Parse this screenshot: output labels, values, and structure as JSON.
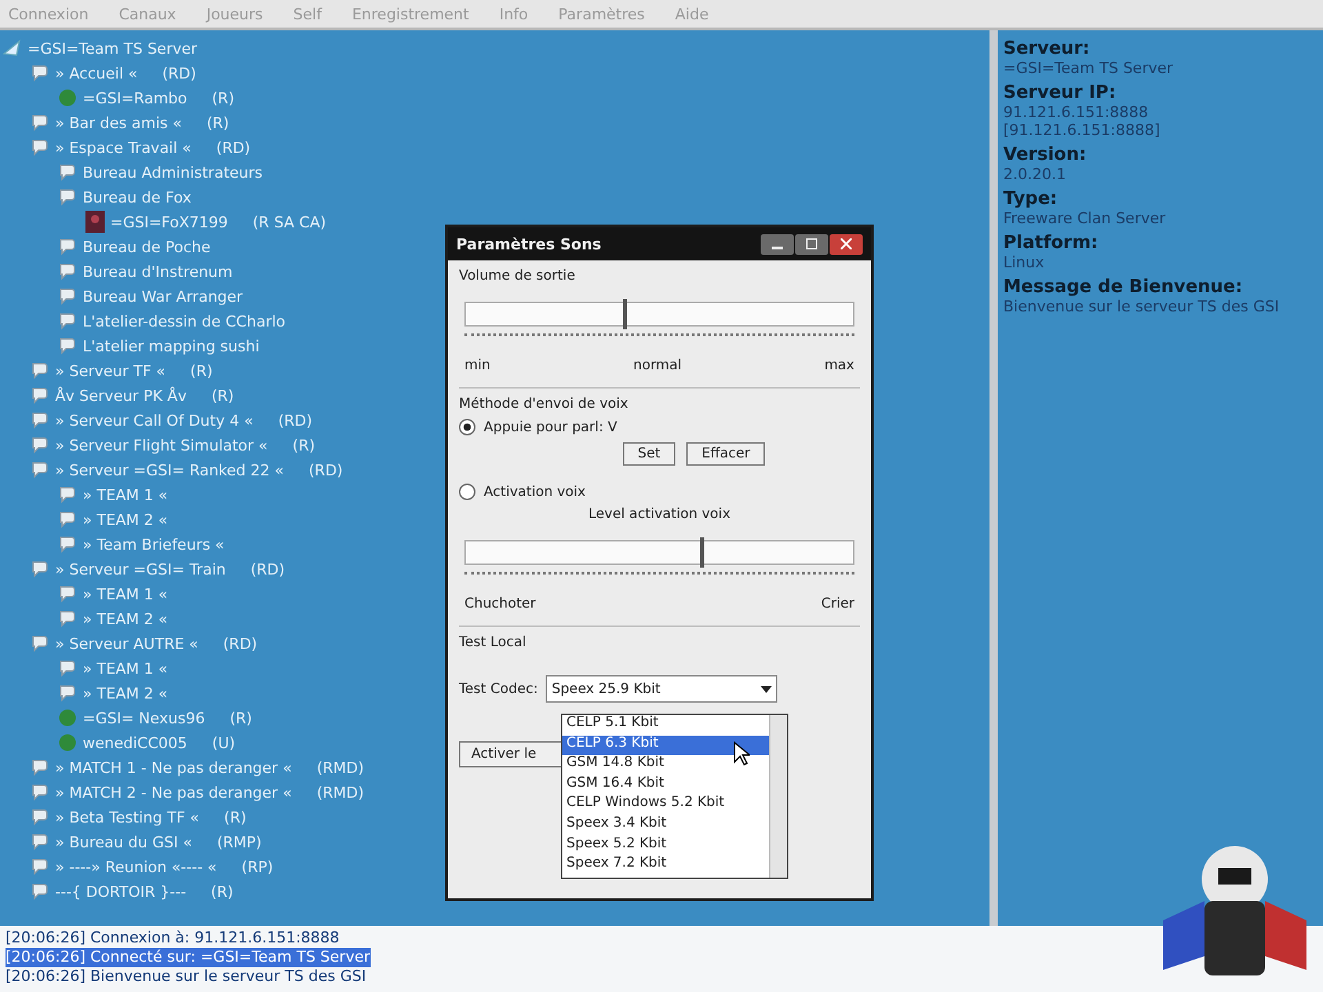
{
  "menu": [
    {
      "label": "Connexion"
    },
    {
      "label": "Canaux"
    },
    {
      "label": "Joueurs"
    },
    {
      "label": "Self"
    },
    {
      "label": "Enregistrement"
    },
    {
      "label": "Info"
    },
    {
      "label": "Paramètres"
    },
    {
      "label": "Aide"
    }
  ],
  "tree": [
    {
      "kind": "server",
      "name": "=GSI=Team TS Server",
      "children": [
        {
          "kind": "channel",
          "name": "» Accueil «",
          "flags": "(RD)",
          "children": [
            {
              "kind": "player",
              "name": "=GSI=Rambo",
              "flags": "(R)"
            }
          ]
        },
        {
          "kind": "channel",
          "name": "» Bar des amis «",
          "flags": "(R)"
        },
        {
          "kind": "channel",
          "name": "» Espace Travail «",
          "flags": "(RD)",
          "children": [
            {
              "kind": "channel",
              "name": "Bureau Administrateurs"
            },
            {
              "kind": "channel",
              "name": "Bureau de Fox",
              "children": [
                {
                  "kind": "admin",
                  "name": "=GSI=FoX7199",
                  "flags": "(R SA CA)"
                }
              ]
            },
            {
              "kind": "channel",
              "name": "Bureau de Poche"
            },
            {
              "kind": "channel",
              "name": "Bureau d'Instrenum"
            },
            {
              "kind": "channel",
              "name": "Bureau War Arranger"
            },
            {
              "kind": "channel",
              "name": "L'atelier-dessin de CCharlo"
            },
            {
              "kind": "channel",
              "name": "L'atelier mapping sushi"
            }
          ]
        },
        {
          "kind": "channel",
          "name": "» Serveur TF «",
          "flags": "(R)"
        },
        {
          "kind": "channel",
          "name": "Åv Serveur PK Åv",
          "flags": "(R)"
        },
        {
          "kind": "channel",
          "name": "» Serveur Call Of Duty 4 «",
          "flags": "(RD)"
        },
        {
          "kind": "channel",
          "name": "» Serveur Flight Simulator «",
          "flags": "(R)"
        },
        {
          "kind": "channel",
          "name": "» Serveur =GSI= Ranked 22 «",
          "flags": "(RD)",
          "children": [
            {
              "kind": "channel",
              "name": "» TEAM 1 «"
            },
            {
              "kind": "channel",
              "name": "» TEAM 2 «"
            },
            {
              "kind": "channel",
              "name": "» Team Briefeurs «"
            }
          ]
        },
        {
          "kind": "channel",
          "name": "» Serveur =GSI= Train",
          "flags": "(RD)",
          "children": [
            {
              "kind": "channel",
              "name": "» TEAM 1 «"
            },
            {
              "kind": "channel",
              "name": "» TEAM 2 «"
            }
          ]
        },
        {
          "kind": "channel",
          "name": "» Serveur AUTRE «",
          "flags": "(RD)",
          "children": [
            {
              "kind": "channel",
              "name": "» TEAM 1 «"
            },
            {
              "kind": "channel",
              "name": "» TEAM 2 «"
            },
            {
              "kind": "player",
              "name": "=GSI= Nexus96",
              "flags": "(R)"
            },
            {
              "kind": "player",
              "name": "wenediCC005",
              "flags": "(U)"
            }
          ]
        },
        {
          "kind": "channel",
          "name": "» MATCH 1 - Ne pas deranger «",
          "flags": "(RMD)"
        },
        {
          "kind": "channel",
          "name": "» MATCH 2 - Ne pas deranger «",
          "flags": "(RMD)"
        },
        {
          "kind": "channel",
          "name": "» Beta Testing TF «",
          "flags": "(R)"
        },
        {
          "kind": "channel",
          "name": "» Bureau du GSI «",
          "flags": "(RMP)"
        },
        {
          "kind": "channel",
          "name": "» ----» Reunion «---- «",
          "flags": "(RP)"
        },
        {
          "kind": "channel",
          "name": "---{ DORTOIR }---",
          "flags": "(R)"
        }
      ]
    }
  ],
  "info": [
    {
      "label": "Serveur:",
      "lines": [
        "=GSI=Team TS Server"
      ]
    },
    {
      "label": "Serveur IP:",
      "lines": [
        "91.121.6.151:8888",
        "[91.121.6.151:8888]"
      ]
    },
    {
      "label": "Version:",
      "lines": [
        "2.0.20.1"
      ]
    },
    {
      "label": "Type:",
      "lines": [
        "Freeware Clan Server"
      ]
    },
    {
      "label": "Platform:",
      "lines": [
        "Linux"
      ]
    },
    {
      "label": "Message de Bienvenue:",
      "lines": [
        "Bienvenue sur le serveur TS des GSI"
      ]
    }
  ],
  "log": [
    {
      "text": "[20:06:26] Connexion à: 91.121.6.151:8888",
      "selected": false
    },
    {
      "text": "[20:06:26] Connecté sur: =GSI=Team TS Server",
      "selected": true
    },
    {
      "text": "[20:06:26] Bienvenue sur le serveur TS des GSI",
      "selected": false
    }
  ],
  "dialog": {
    "title": "Paramètres Sons",
    "output_volume": {
      "label": "Volume de sortie",
      "level": 0.41,
      "ticks": [
        "min",
        "normal",
        "max"
      ]
    },
    "voice_method": {
      "label": "Méthode d'envoi de voix",
      "push_to_talk": {
        "label": "Appuie pour parl: V",
        "selected": true
      },
      "buttons": [
        "Set",
        "Effacer"
      ],
      "voice_activation": {
        "label": "Activation voix",
        "selected": false
      },
      "activation_level": {
        "label": "Level activation voix",
        "level": 0.61,
        "ticks": [
          "Chuchoter",
          "Crier"
        ]
      }
    },
    "test_local": {
      "label": "Test Local",
      "codec_label": "Test Codec:",
      "codec_value": "Speex 25.9 Kbit",
      "button": "Activer le",
      "options": [
        {
          "label": "CELP 5.1 Kbit",
          "selected": false
        },
        {
          "label": "CELP 6.3 Kbit",
          "selected": true
        },
        {
          "label": "GSM 14.8 Kbit",
          "selected": false
        },
        {
          "label": "GSM 16.4 Kbit",
          "selected": false
        },
        {
          "label": "CELP Windows 5.2 Kbit",
          "selected": false
        },
        {
          "label": "Speex 3.4 Kbit",
          "selected": false
        },
        {
          "label": "Speex 5.2 Kbit",
          "selected": false
        },
        {
          "label": "Speex 7.2 Kbit",
          "selected": false
        }
      ]
    }
  }
}
